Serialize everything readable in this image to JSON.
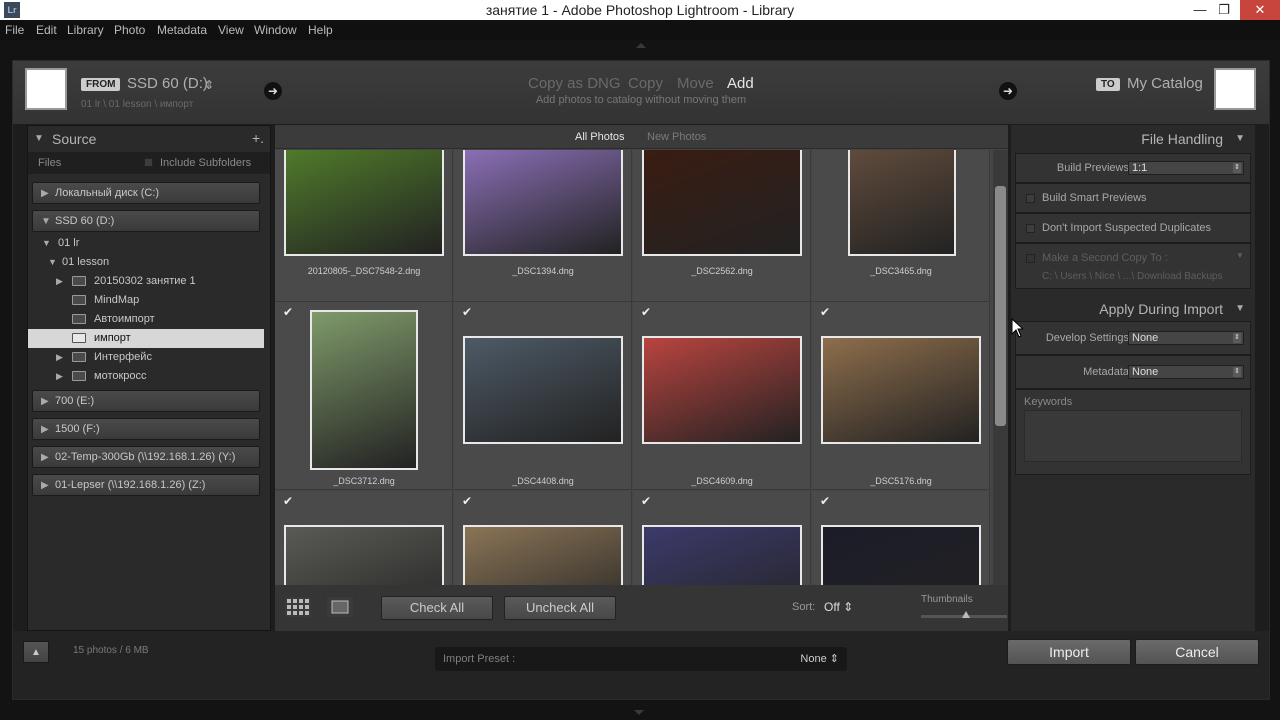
{
  "window": {
    "title": "занятие 1 - Adobe Photoshop Lightroom - Library",
    "app_icon": "Lr",
    "min": "—",
    "max": "❐",
    "close": "✕"
  },
  "menu": [
    "File",
    "Edit",
    "Library",
    "Photo",
    "Metadata",
    "View",
    "Window",
    "Help"
  ],
  "from": {
    "badge": "FROM",
    "device": "SSD 60 (D:)",
    "device_arrow": "⇕",
    "path": "01 lr \\ 01 lesson \\ импорт"
  },
  "modes": {
    "copy_dng": "Copy as DNG",
    "copy": "Copy",
    "move": "Move",
    "add": "Add",
    "description": "Add photos to catalog without moving them"
  },
  "to": {
    "badge": "TO",
    "label": "My Catalog"
  },
  "arrow_glyph": "➜",
  "source": {
    "title": "Source",
    "plus": "+.",
    "files_label": "Files",
    "include_subfolders": "Include Subfolders",
    "volumes_top": [
      "Локальный диск (C:)",
      "SSD 60 (D:)"
    ],
    "tree": [
      "01 lr",
      "01 lesson",
      "20150302 занятие 1",
      "MindMap",
      "Автоимпорт",
      "импорт",
      "Интерфейс",
      "мотокросс"
    ],
    "volumes_bottom": [
      "700 (E:)",
      "1500 (F:)",
      "02-Temp-300Gb (\\\\192.168.1.26) (Y:)",
      "01-Lepser (\\\\192.168.1.26) (Z:)"
    ]
  },
  "filters": {
    "all": "All Photos",
    "new": "New Photos"
  },
  "check_mark": "✔",
  "photos": [
    {
      "name": "20120805-_DSC7548-2.dng",
      "tone": "#4f7a2a"
    },
    {
      "name": "_DSC1394.dng",
      "tone": "#8a6fb5"
    },
    {
      "name": "_DSC2562.dng",
      "tone": "#3a1c12"
    },
    {
      "name": "_DSC3465.dng",
      "tone": "#6a5240"
    },
    {
      "name": "_DSC3712.dng",
      "tone": "#7f9a6a"
    },
    {
      "name": "_DSC4408.dng",
      "tone": "#4d5a66"
    },
    {
      "name": "_DSC4609.dng",
      "tone": "#b9443f"
    },
    {
      "name": "_DSC5176.dng",
      "tone": "#8e6e4c"
    },
    {
      "name": "",
      "tone": "#5a5a55"
    },
    {
      "name": "",
      "tone": "#8a7456"
    },
    {
      "name": "",
      "tone": "#3c3a6a"
    },
    {
      "name": "",
      "tone": "#1c1c28"
    }
  ],
  "toolbar": {
    "check_all": "Check All",
    "uncheck_all": "Uncheck All",
    "sort_label": "Sort:",
    "sort_value": "Off ⇕",
    "thumbnails_label": "Thumbnails"
  },
  "file_handling": {
    "title": "File Handling",
    "build_previews_label": "Build Previews",
    "build_previews_value": "1:1",
    "build_smart_previews": "Build Smart Previews",
    "no_duplicates": "Don't Import Suspected Duplicates",
    "second_copy": "Make a Second Copy To :",
    "second_copy_path": "C: \\ Users \\ Nice \\ ...\\ Download Backups"
  },
  "apply_during_import": {
    "title": "Apply During Import",
    "develop_label": "Develop Settings",
    "develop_value": "None",
    "metadata_label": "Metadata",
    "metadata_value": "None",
    "keywords_label": "Keywords"
  },
  "bottom": {
    "collapse": "▲",
    "count": "15 photos / 6 MB",
    "preset_label": "Import Preset :",
    "preset_value": "None ⇕",
    "import": "Import",
    "cancel": "Cancel"
  }
}
